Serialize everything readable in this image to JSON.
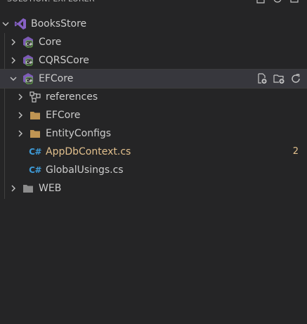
{
  "explorer": {
    "title": "SOLUTION: EXPLORER",
    "header_actions": [
      "new-file-icon",
      "refresh-icon",
      "collapse-all-icon"
    ]
  },
  "tree": {
    "root": {
      "label": "BooksStore",
      "icon": "visual-studio-solution-icon",
      "expanded": true
    },
    "projects": [
      {
        "label": "Core",
        "icon": "csharp-project-icon",
        "expanded": false
      },
      {
        "label": "CQRSCore",
        "icon": "csharp-project-icon",
        "expanded": false
      },
      {
        "label": "EFCore",
        "icon": "csharp-project-icon",
        "expanded": true,
        "selected": true,
        "actions": [
          "new-file-icon",
          "new-folder-icon",
          "refresh-icon"
        ],
        "children": [
          {
            "label": "references",
            "icon": "references-icon",
            "expandable": true
          },
          {
            "label": "EFCore",
            "icon": "folder-icon",
            "expandable": true
          },
          {
            "label": "EntityConfigs",
            "icon": "folder-icon",
            "expandable": true
          },
          {
            "label": "AppDbContext.cs",
            "icon": "csharp-file-icon",
            "expandable": false,
            "modified": true,
            "badge": "2"
          },
          {
            "label": "GlobalUsings.cs",
            "icon": "csharp-file-icon",
            "expandable": false
          }
        ]
      },
      {
        "label": "WEB",
        "icon": "folder-grey-icon",
        "expanded": false
      }
    ]
  },
  "colors": {
    "background": "#252526",
    "selected_row": "#37373d",
    "text": "#cccccc",
    "modified_text": "#e2c08d",
    "folder": "#c09553",
    "csharp": "#3e9bd8",
    "vs_purple": "#8661c5"
  },
  "glyphs": {
    "csharp": "C#"
  }
}
